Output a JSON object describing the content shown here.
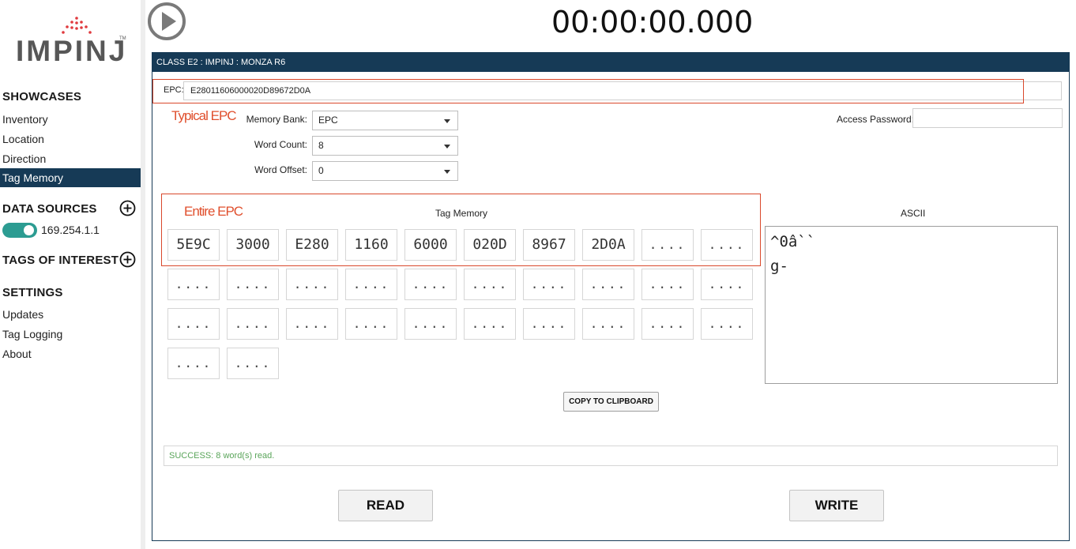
{
  "brand": {
    "name": "IMPINJ",
    "trademark": "TM"
  },
  "sidebar": {
    "showcases_title": "SHOWCASES",
    "showcases": [
      {
        "label": "Inventory"
      },
      {
        "label": "Location"
      },
      {
        "label": "Direction"
      },
      {
        "label": "Tag Memory",
        "active": true
      }
    ],
    "data_sources_title": "DATA SOURCES",
    "data_source": {
      "label": "169.254.1.1",
      "enabled": true
    },
    "tags_of_interest_title": "TAGS OF INTEREST",
    "settings_title": "SETTINGS",
    "settings": [
      {
        "label": "Updates"
      },
      {
        "label": "Tag Logging"
      },
      {
        "label": "About"
      }
    ]
  },
  "timer": "00:00:00.000",
  "panel": {
    "header": "CLASS E2 : IMPINJ : MONZA R6",
    "epc_label": "EPC:",
    "epc_value": "E28011606000020D89672D0A",
    "annotation_typical": "Typical EPC",
    "annotation_entire": "Entire EPC",
    "memory_bank_label": "Memory Bank:",
    "memory_bank_value": "EPC",
    "word_count_label": "Word Count:",
    "word_count_value": "8",
    "word_offset_label": "Word Offset:",
    "word_offset_value": "0",
    "access_password_label": "Access Password:",
    "access_password_value": "",
    "tag_memory_title": "Tag Memory",
    "ascii_title": "ASCII",
    "words": [
      "5E9C",
      "3000",
      "E280",
      "1160",
      "6000",
      "020D",
      "8967",
      "2D0A",
      "....",
      "....",
      "....",
      "....",
      "....",
      "....",
      "....",
      "....",
      "....",
      "....",
      "....",
      "....",
      "....",
      "....",
      "....",
      "....",
      "....",
      "....",
      "....",
      "....",
      "....",
      "....",
      "....",
      "...."
    ],
    "ascii_text": "^0â``\ng-",
    "copy_button": "COPY TO CLIPBOARD",
    "status": "SUCCESS: 8 word(s) read.",
    "read_button": "READ",
    "write_button": "WRITE"
  },
  "colors": {
    "navy": "#163a56",
    "accent_red": "#d9482b",
    "toggle_teal": "#2c9c92",
    "success_green": "#5aa55a",
    "logo_dots_red": "#e03a3e"
  }
}
